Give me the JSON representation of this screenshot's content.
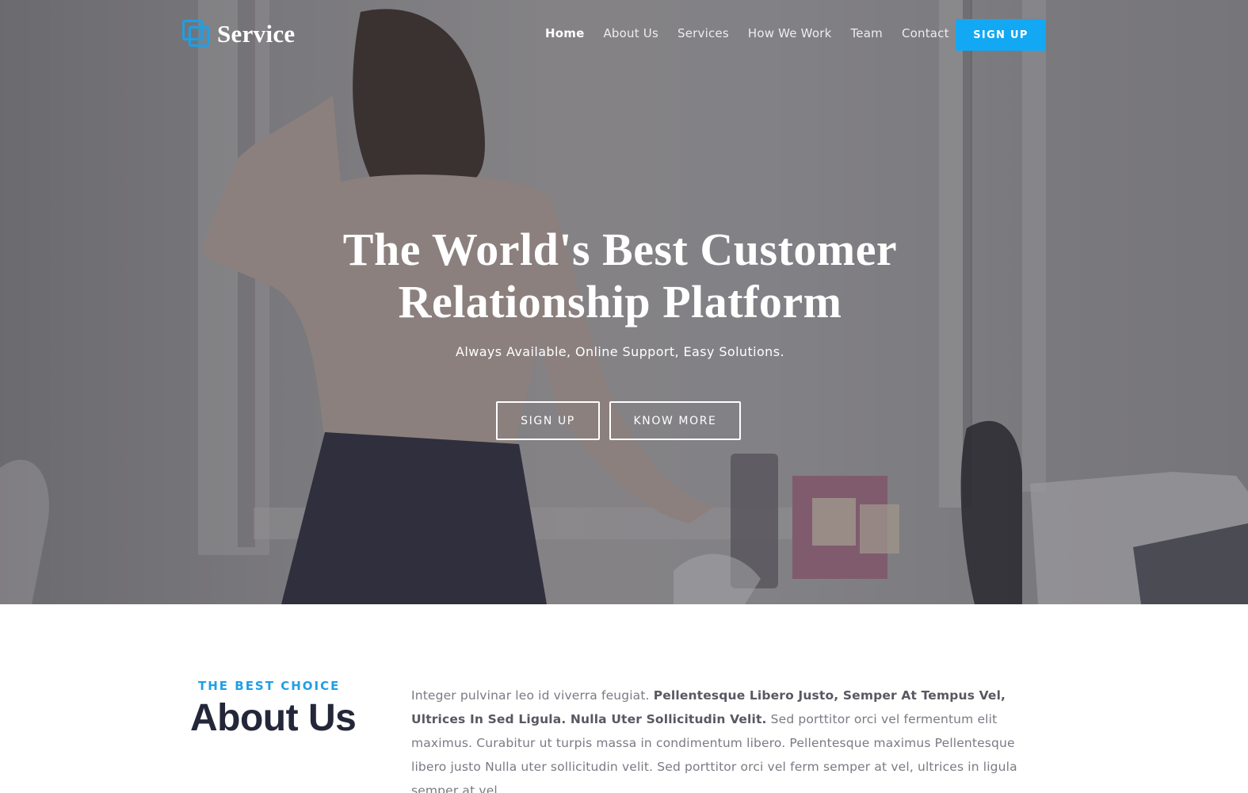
{
  "brand": {
    "name": "Service",
    "icon": "overlapping-squares-icon",
    "accent_color": "#1e9fe6"
  },
  "nav": {
    "items": [
      {
        "label": "Home",
        "active": true
      },
      {
        "label": "About Us",
        "active": false
      },
      {
        "label": "Services",
        "active": false
      },
      {
        "label": "How We Work",
        "active": false
      },
      {
        "label": "Team",
        "active": false
      },
      {
        "label": "Contact",
        "active": false
      }
    ],
    "signup_label": "SIGN UP",
    "signup_color": "#13a8f3"
  },
  "hero": {
    "title_line1": "The World's Best Customer",
    "title_line2": "Relationship Platform",
    "subtitle": "Always Available, Online Support, Easy Solutions.",
    "primary_button": "SIGN UP",
    "secondary_button": "KNOW MORE"
  },
  "about": {
    "eyebrow": "THE BEST CHOICE",
    "title": "About Us",
    "text_intro": "Integer pulvinar leo id viverra feugiat.",
    "text_bold": "Pellentesque Libero Justo, Semper At Tempus Vel, Ultrices In Sed Ligula. Nulla Uter Sollicitudin Velit.",
    "text_rest": "Sed porttitor orci vel fermentum elit maximus. Curabitur ut turpis massa in condimentum libero. Pellentesque maximus Pellentesque libero justo Nulla uter sollicitudin velit. Sed porttitor orci vel ferm semper at vel, ultrices in ligula semper at vel."
  }
}
